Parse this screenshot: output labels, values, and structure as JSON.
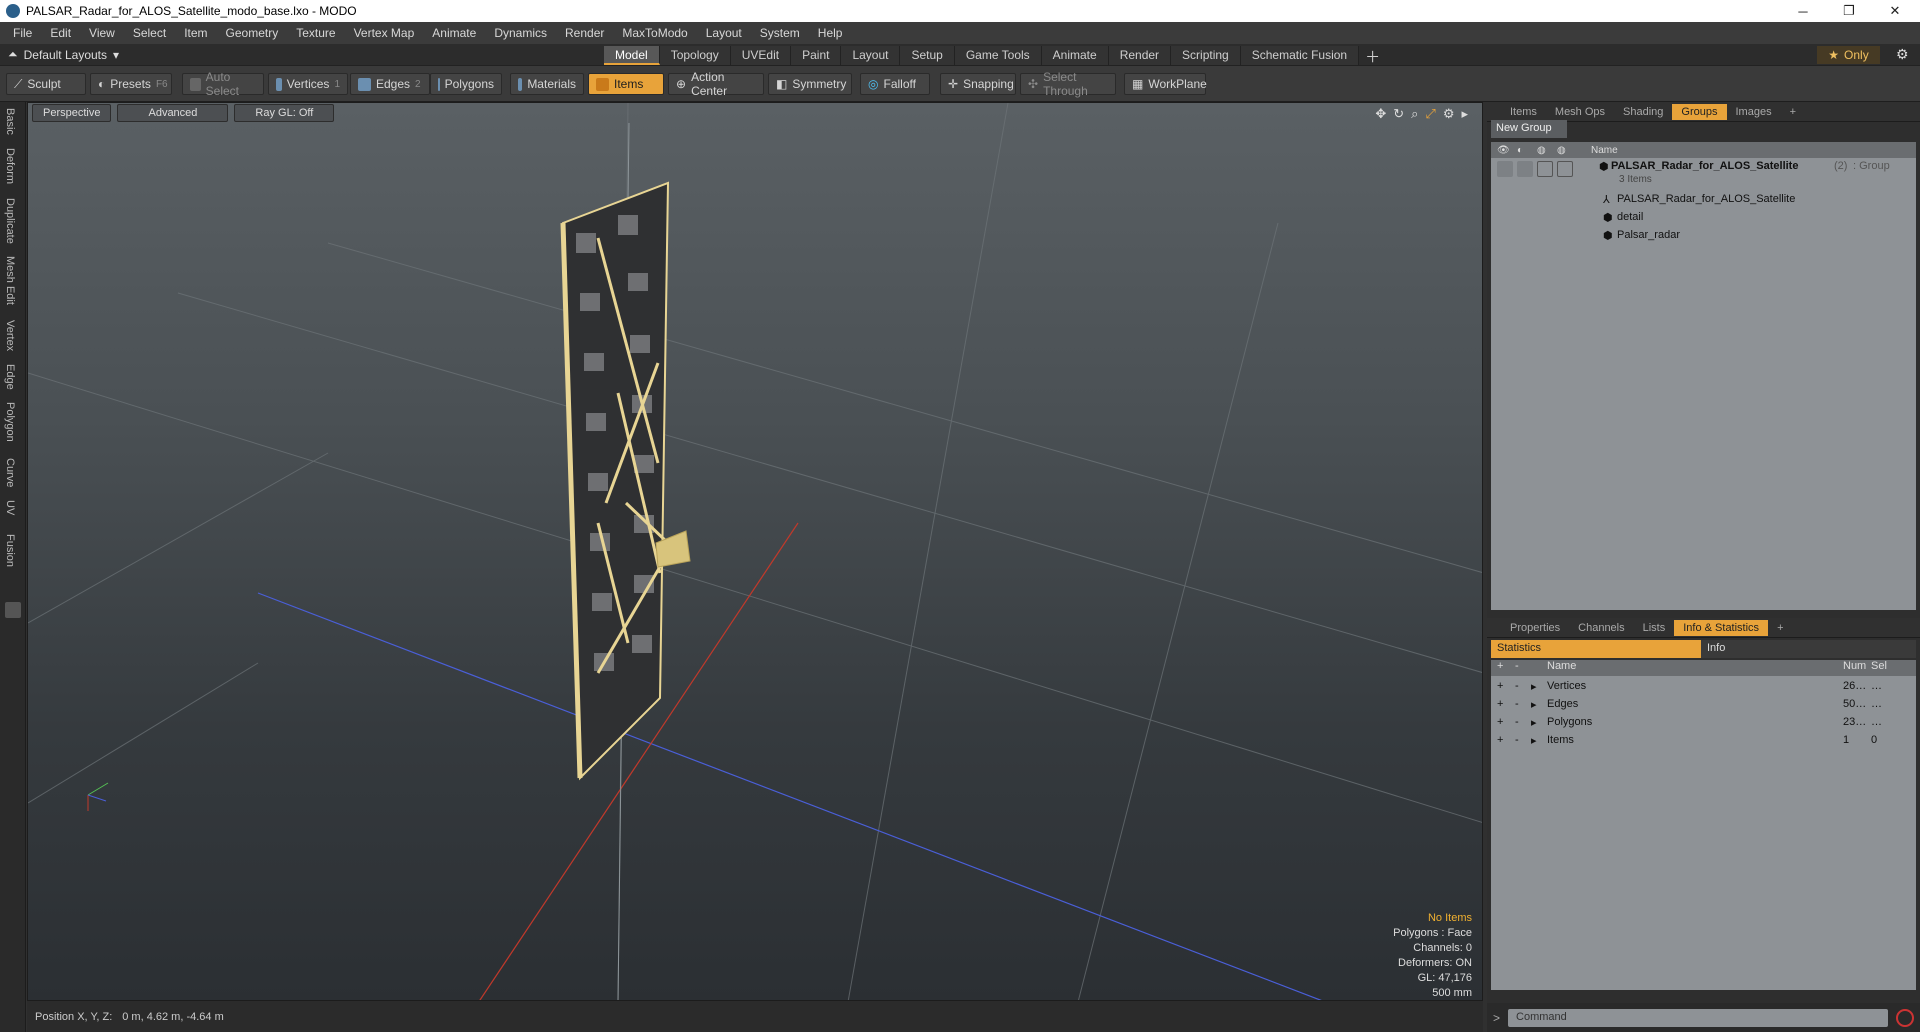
{
  "window": {
    "title": "PALSAR_Radar_for_ALOS_Satellite_modo_base.lxo - MODO",
    "minimize": "─",
    "maximize": "❐",
    "close": "✕"
  },
  "menu": [
    "File",
    "Edit",
    "View",
    "Select",
    "Item",
    "Geometry",
    "Texture",
    "Vertex Map",
    "Animate",
    "Dynamics",
    "Render",
    "MaxToModo",
    "Layout",
    "System",
    "Help"
  ],
  "modebar": {
    "layout_label": "Default Layouts",
    "tabs": [
      "Model",
      "Topology",
      "UVEdit",
      "Paint",
      "Layout",
      "Setup",
      "Game Tools",
      "Animate",
      "Render",
      "Scripting",
      "Schematic Fusion"
    ],
    "active_tab": "Model",
    "only_label": "Only"
  },
  "toolbar": {
    "sculpt": "Sculpt",
    "presets": "Presets",
    "presets_key": "F6",
    "auto_select": "Auto Select",
    "vertices": "Vertices",
    "vertices_key": "1",
    "edges": "Edges",
    "edges_key": "2",
    "polygons": "Polygons",
    "materials": "Materials",
    "items": "Items",
    "action_center": "Action Center",
    "symmetry": "Symmetry",
    "falloff": "Falloff",
    "snapping": "Snapping",
    "select_through": "Select Through",
    "workplane": "WorkPlane"
  },
  "left_tabs": [
    "Basic",
    "Deform",
    "Duplicate",
    "Mesh Edit",
    "Vertex",
    "Edge",
    "Polygon",
    "Curve",
    "UV",
    "Fusion"
  ],
  "viewport": {
    "perspective": "Perspective",
    "advanced": "Advanced",
    "raygl": "Ray GL: Off",
    "info": {
      "no_items": "No Items",
      "polygons": "Polygons : Face",
      "channels": "Channels: 0",
      "deformers": "Deformers: ON",
      "gl": "GL: 47,176",
      "scale": "500 mm"
    }
  },
  "status": {
    "label": "Position X, Y, Z:",
    "value": "0 m, 4.62 m, -4.64 m"
  },
  "groups_panel": {
    "tabs": [
      "Items",
      "Mesh Ops",
      "Shading",
      "Groups",
      "Images"
    ],
    "active_tab": "Groups",
    "new_group": "New Group",
    "column_name": "Name",
    "root": {
      "name": "PALSAR_Radar_for_ALOS_Satellite",
      "count": "(2)",
      "type": ": Group",
      "sub": "3 Items"
    },
    "children": [
      "PALSAR_Radar_for_ALOS_Satellite",
      "detail",
      "Palsar_radar"
    ]
  },
  "stats_panel": {
    "tabs": [
      "Properties",
      "Channels",
      "Lists",
      "Info & Statistics"
    ],
    "active_tab": "Info & Statistics",
    "sub_tabs": [
      "Statistics",
      "Info"
    ],
    "columns": {
      "name": "Name",
      "num": "Num",
      "sel": "Sel"
    },
    "rows": [
      {
        "name": "Vertices",
        "num": "26…",
        "sel": "…"
      },
      {
        "name": "Edges",
        "num": "50…",
        "sel": "…"
      },
      {
        "name": "Polygons",
        "num": "23…",
        "sel": "…"
      },
      {
        "name": "Items",
        "num": "1",
        "sel": "0"
      }
    ]
  },
  "command": {
    "placeholder": "Command"
  },
  "colors": {
    "accent": "#e8a33a",
    "panel": "#8e9296",
    "model": "#e8d594"
  }
}
